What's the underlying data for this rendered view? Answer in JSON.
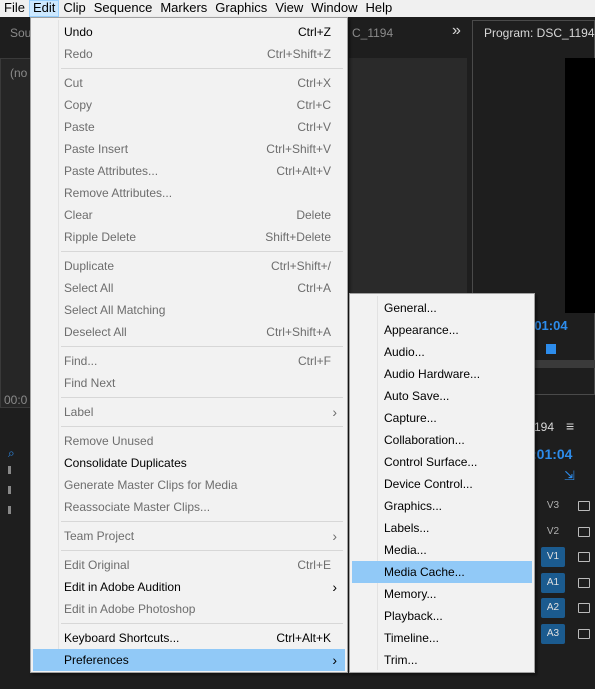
{
  "menubar": [
    "File",
    "Edit",
    "Clip",
    "Sequence",
    "Markers",
    "Graphics",
    "View",
    "Window",
    "Help"
  ],
  "background": {
    "source_tab": "Sou",
    "source_clip_tail": "C_1194",
    "no_clip": "(no",
    "chevrons": "»",
    "program_title": "Program: DSC_1194",
    "program_time": ":01:04",
    "source_time": "00:0",
    "timeline_tail": "194",
    "menu_icon": "≡",
    "timeline_time": ":01:04",
    "tracks": [
      "V3",
      "V2",
      "V1",
      "A1",
      "A2",
      "A3"
    ]
  },
  "edit_menu": {
    "items": [
      {
        "label": "Undo",
        "shortcut": "Ctrl+Z",
        "enabled": true
      },
      {
        "label": "Redo",
        "shortcut": "Ctrl+Shift+Z",
        "enabled": false
      },
      {
        "sep": true
      },
      {
        "label": "Cut",
        "shortcut": "Ctrl+X",
        "enabled": false
      },
      {
        "label": "Copy",
        "shortcut": "Ctrl+C",
        "enabled": false
      },
      {
        "label": "Paste",
        "shortcut": "Ctrl+V",
        "enabled": false
      },
      {
        "label": "Paste Insert",
        "shortcut": "Ctrl+Shift+V",
        "enabled": false
      },
      {
        "label": "Paste Attributes...",
        "shortcut": "Ctrl+Alt+V",
        "enabled": false
      },
      {
        "label": "Remove Attributes...",
        "shortcut": "",
        "enabled": false
      },
      {
        "label": "Clear",
        "shortcut": "Delete",
        "enabled": false
      },
      {
        "label": "Ripple Delete",
        "shortcut": "Shift+Delete",
        "enabled": false
      },
      {
        "sep": true
      },
      {
        "label": "Duplicate",
        "shortcut": "Ctrl+Shift+/",
        "enabled": false
      },
      {
        "label": "Select All",
        "shortcut": "Ctrl+A",
        "enabled": false
      },
      {
        "label": "Select All Matching",
        "shortcut": "",
        "enabled": false
      },
      {
        "label": "Deselect All",
        "shortcut": "Ctrl+Shift+A",
        "enabled": false
      },
      {
        "sep": true
      },
      {
        "label": "Find...",
        "shortcut": "Ctrl+F",
        "enabled": false
      },
      {
        "label": "Find Next",
        "shortcut": "",
        "enabled": false
      },
      {
        "sep": true
      },
      {
        "label": "Label",
        "shortcut": "",
        "enabled": false,
        "submenu": true
      },
      {
        "sep": true
      },
      {
        "label": "Remove Unused",
        "shortcut": "",
        "enabled": false
      },
      {
        "label": "Consolidate Duplicates",
        "shortcut": "",
        "enabled": true
      },
      {
        "label": "Generate Master Clips for Media",
        "shortcut": "",
        "enabled": false
      },
      {
        "label": "Reassociate Master Clips...",
        "shortcut": "",
        "enabled": false
      },
      {
        "sep": true
      },
      {
        "label": "Team Project",
        "shortcut": "",
        "enabled": false,
        "submenu": true
      },
      {
        "sep": true
      },
      {
        "label": "Edit Original",
        "shortcut": "Ctrl+E",
        "enabled": false
      },
      {
        "label": "Edit in Adobe Audition",
        "shortcut": "",
        "enabled": true,
        "submenu": true
      },
      {
        "label": "Edit in Adobe Photoshop",
        "shortcut": "",
        "enabled": false
      },
      {
        "sep": true
      },
      {
        "label": "Keyboard Shortcuts...",
        "shortcut": "Ctrl+Alt+K",
        "enabled": true
      },
      {
        "label": "Preferences",
        "shortcut": "",
        "enabled": true,
        "submenu": true,
        "highlighted": true
      }
    ]
  },
  "preferences_submenu": {
    "items": [
      {
        "label": "General..."
      },
      {
        "label": "Appearance..."
      },
      {
        "label": "Audio..."
      },
      {
        "label": "Audio Hardware..."
      },
      {
        "label": "Auto Save..."
      },
      {
        "label": "Capture..."
      },
      {
        "label": "Collaboration..."
      },
      {
        "label": "Control Surface..."
      },
      {
        "label": "Device Control..."
      },
      {
        "label": "Graphics..."
      },
      {
        "label": "Labels..."
      },
      {
        "label": "Media..."
      },
      {
        "label": "Media Cache...",
        "highlighted": true
      },
      {
        "label": "Memory..."
      },
      {
        "label": "Playback..."
      },
      {
        "label": "Timeline..."
      },
      {
        "label": "Trim..."
      }
    ]
  },
  "colors": {
    "highlight": "#91c9f7",
    "menubar_active": "#cce8ff",
    "accent": "#2d8ceb",
    "track_on": "#1b5b8f"
  }
}
